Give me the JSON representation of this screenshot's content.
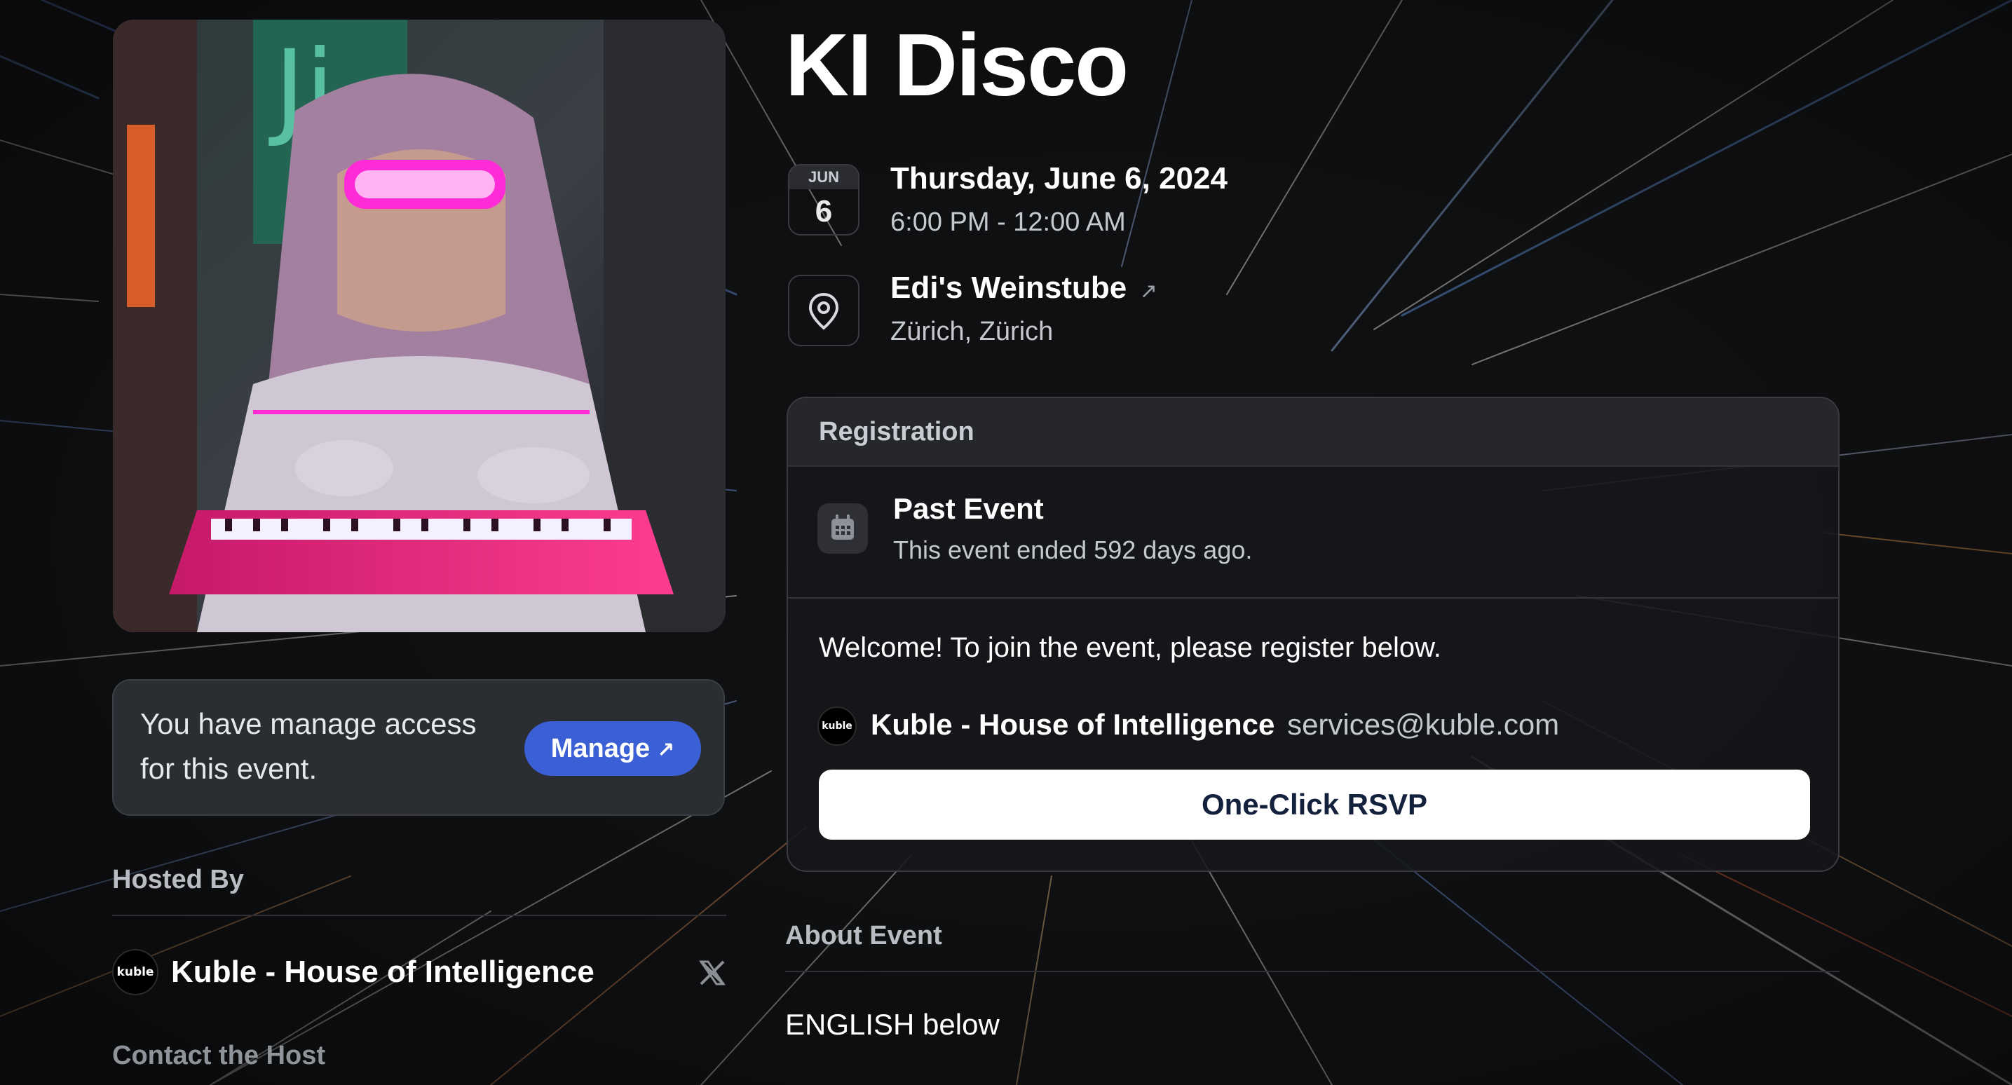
{
  "event": {
    "title": "KI Disco",
    "date_month": "JUN",
    "date_day": "6",
    "date_full": "Thursday, June 6, 2024",
    "time_range": "6:00 PM - 12:00 AM",
    "venue": "Edi's Weinstube",
    "venue_arrow": "↗",
    "city": "Zürich, Zürich"
  },
  "manage": {
    "text": "You have manage access for this event.",
    "button_label": "Manage",
    "button_arrow": "↗"
  },
  "hosted_by": {
    "label": "Hosted By",
    "host_name": "Kuble - House of Intelligence",
    "avatar_text": "kuble",
    "social_icon": "x-icon",
    "contact_label": "Contact the Host"
  },
  "registration": {
    "header": "Registration",
    "status_title": "Past Event",
    "status_text": "This event ended 592 days ago.",
    "welcome": "Welcome! To join the event, please register below.",
    "registrant_name": "Kuble - House of Intelligence",
    "registrant_email": "services@kuble.com",
    "avatar_text": "kuble",
    "rsvp_label": "One-Click RSVP"
  },
  "about": {
    "label": "About Event",
    "first_line": "ENGLISH below"
  },
  "colors": {
    "background": "#101113",
    "manage_button": "#3b5fd4",
    "rsvp_button": "#ffffff",
    "cover_accent": "#ff2bd6"
  }
}
